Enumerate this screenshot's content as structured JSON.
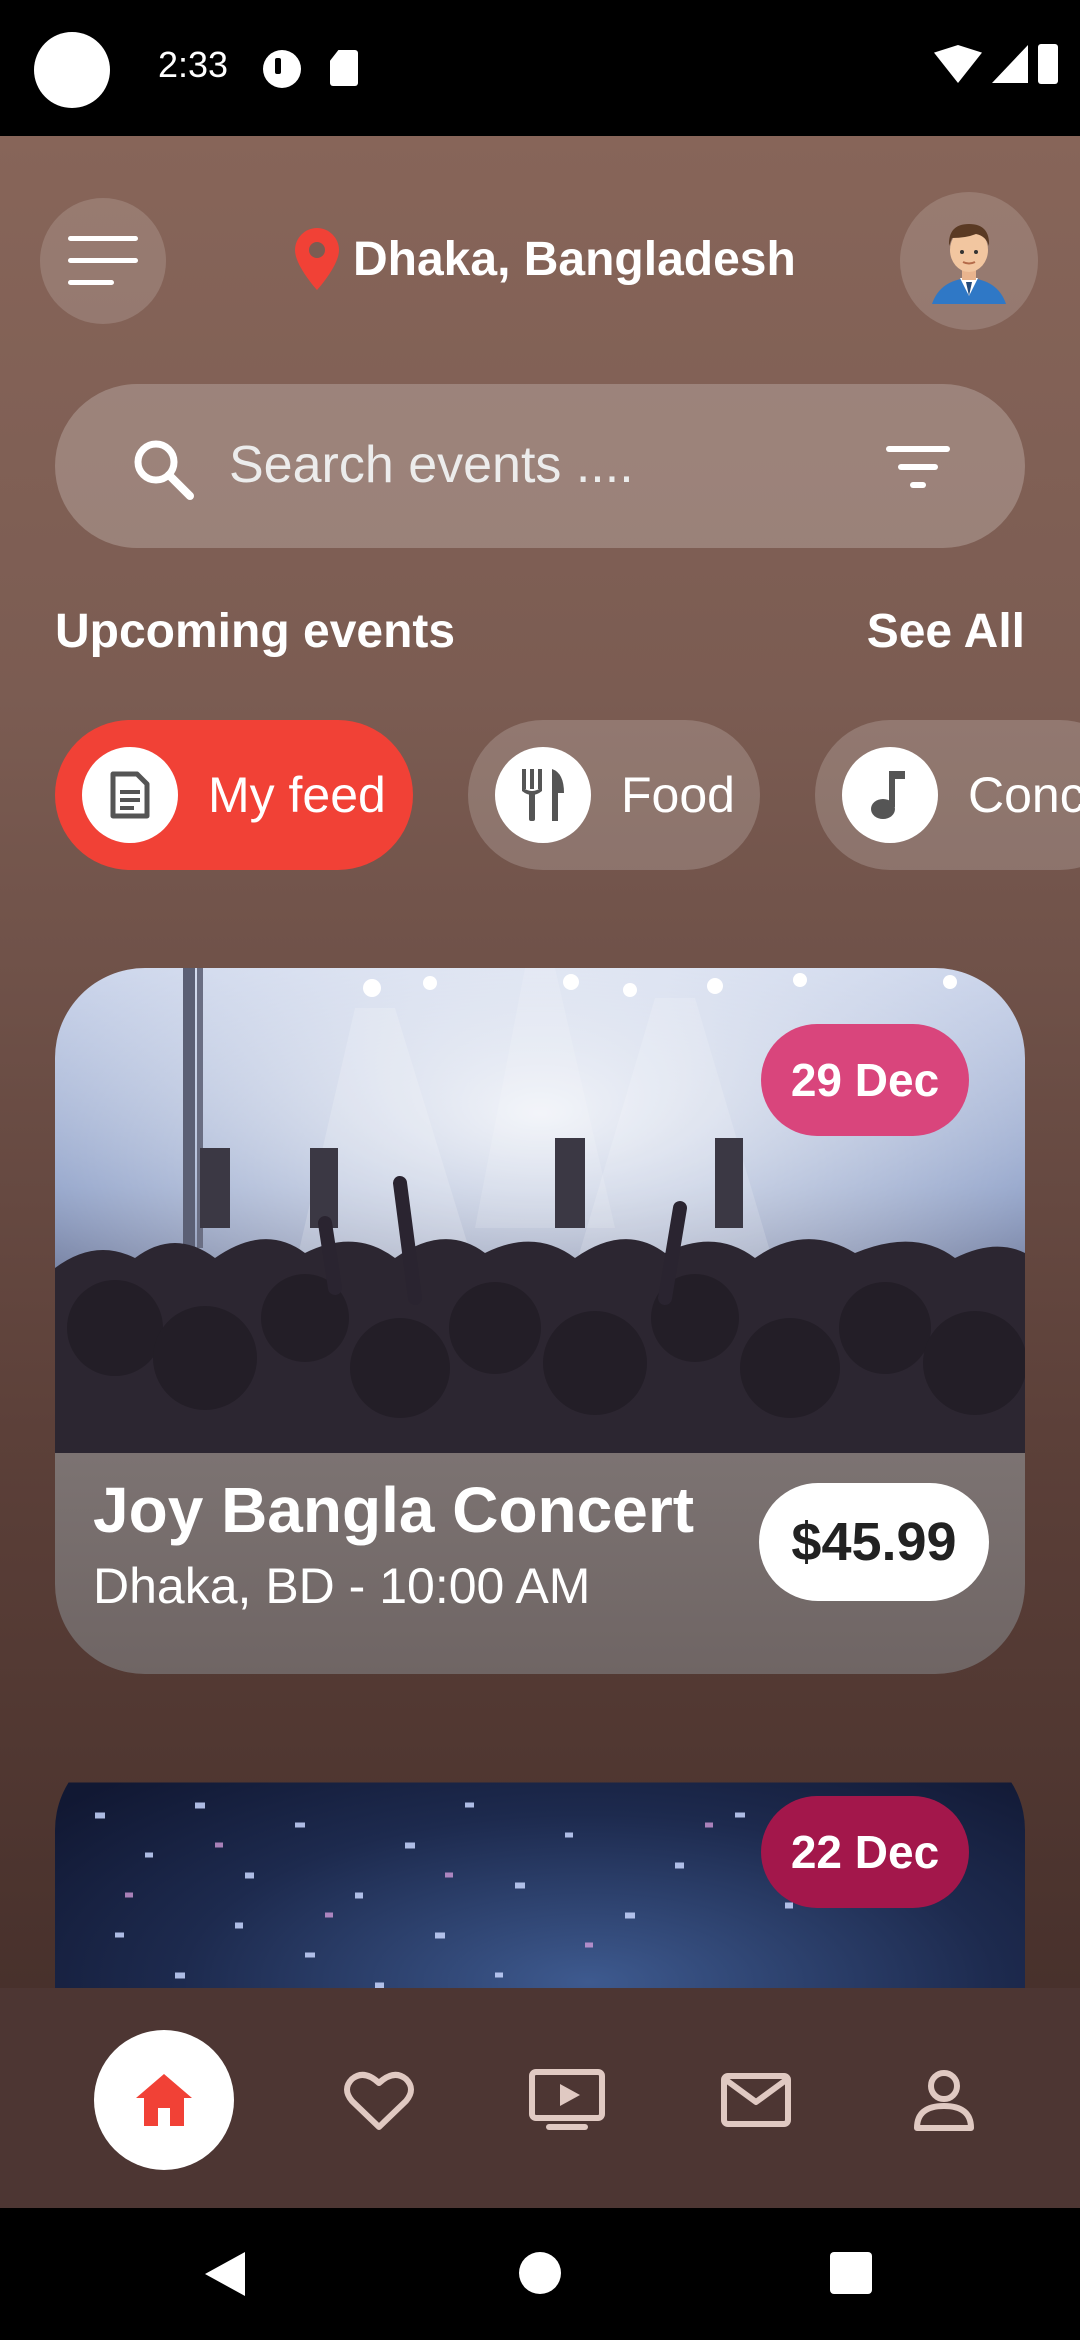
{
  "status_bar": {
    "time": "2:33"
  },
  "header": {
    "location": "Dhaka, Bangladesh",
    "icons": {
      "menu": "menu-icon",
      "pin": "location-pin-icon",
      "avatar": "avatar"
    },
    "pin_color": "#f14136"
  },
  "search": {
    "placeholder": "Search events ....",
    "value": ""
  },
  "section": {
    "title": "Upcoming events",
    "see_all": "See All"
  },
  "categories": [
    {
      "label": "My feed",
      "icon": "feed-icon",
      "active": true
    },
    {
      "label": "Food",
      "icon": "restaurant-icon",
      "active": false
    },
    {
      "label": "Conc",
      "icon": "music-note-icon",
      "active": false
    }
  ],
  "events": [
    {
      "title": "Joy Bangla Concert",
      "subtitle": "Dhaka, BD - 10:00 AM",
      "price": "$45.99",
      "date": "29 Dec",
      "badge_color": "#d9457c"
    },
    {
      "date": "22 Dec",
      "badge_color": "#a3174b"
    }
  ],
  "bottom_nav": {
    "items": [
      {
        "icon": "home-icon",
        "active": true
      },
      {
        "icon": "heart-icon",
        "active": false
      },
      {
        "icon": "video-icon",
        "active": false
      },
      {
        "icon": "mail-icon",
        "active": false
      },
      {
        "icon": "profile-icon",
        "active": false
      }
    ],
    "accent": "#f14136"
  },
  "colors": {
    "accent": "#f14136",
    "background_top": "#876559",
    "background_bottom": "#48312c"
  }
}
